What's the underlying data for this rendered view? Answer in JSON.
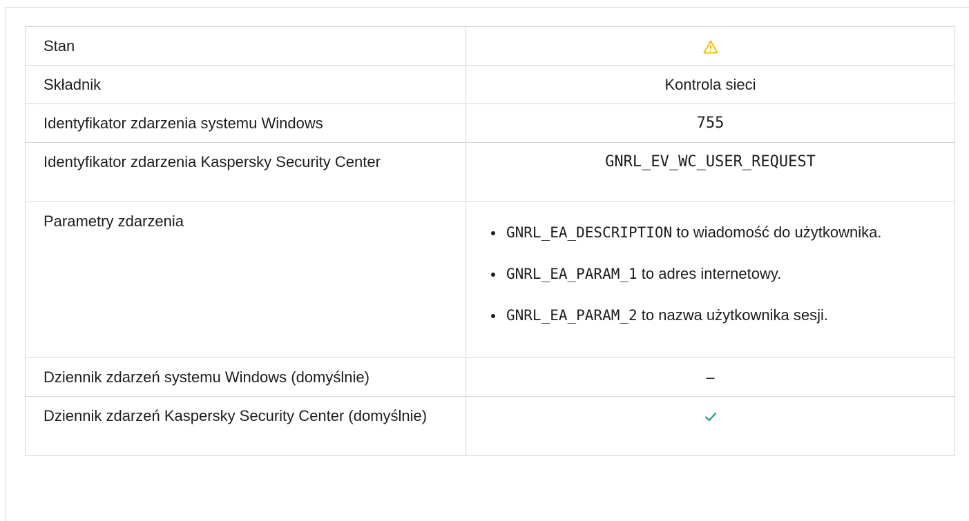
{
  "rows": [
    {
      "label": "Stan",
      "icon": "warning-icon",
      "icon_color": "#f2c200"
    },
    {
      "label": "Składnik",
      "value": "Kontrola sieci"
    },
    {
      "label": "Identyfikator zdarzenia systemu Windows",
      "value": "755"
    },
    {
      "label": "Identyfikator zdarzenia Kaspersky Security Center",
      "value": "GNRL_EV_WC_USER_REQUEST"
    },
    {
      "label": "Parametry zdarzenia",
      "params": [
        {
          "code": "GNRL_EA_DESCRIPTION",
          "text": " to wiadomość do użytkownika."
        },
        {
          "code": "GNRL_EA_PARAM_1",
          "text": " to adres internetowy."
        },
        {
          "code": "GNRL_EA_PARAM_2",
          "text": " to nazwa użytkownika sesji."
        }
      ]
    },
    {
      "label": "Dziennik zdarzeń systemu Windows (domyślnie)",
      "value": "–"
    },
    {
      "label": "Dziennik zdarzeń Kaspersky Security Center (domyślnie)",
      "icon": "check-icon",
      "icon_color": "#1a9e6f"
    }
  ]
}
